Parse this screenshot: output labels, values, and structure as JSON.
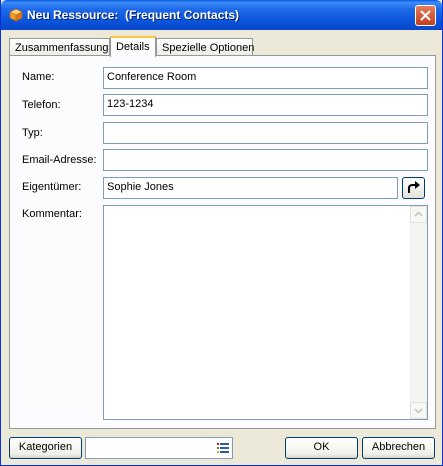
{
  "window": {
    "title": "Neu Ressource:  (Frequent Contacts)"
  },
  "tabs": [
    {
      "label": "Zusammenfassung",
      "active": false
    },
    {
      "label": "Details",
      "active": true
    },
    {
      "label": "Spezielle Optionen",
      "active": false
    }
  ],
  "form": {
    "name_label": "Name:",
    "name_value": "Conference Room",
    "phone_label": "Telefon:",
    "phone_value": "123-1234",
    "type_label": "Typ:",
    "type_value": "",
    "email_label": "Email-Adresse:",
    "email_value": "",
    "owner_label": "Eigentümer:",
    "owner_value": "Sophie Jones",
    "comment_label": "Kommentar:",
    "comment_value": ""
  },
  "footer": {
    "categories_label": "Kategorien",
    "categories_value": "",
    "ok_label": "OK",
    "cancel_label": "Abbrechen"
  },
  "icons": {
    "title_icon": "resource-cube-icon",
    "owner_action_icon": "redo-arrow-icon",
    "categories_icon": "list-icon"
  },
  "colors": {
    "titlebar": "#0a54dc",
    "active_tab_accent": "#ffc83c",
    "field_border": "#7f9db9"
  }
}
